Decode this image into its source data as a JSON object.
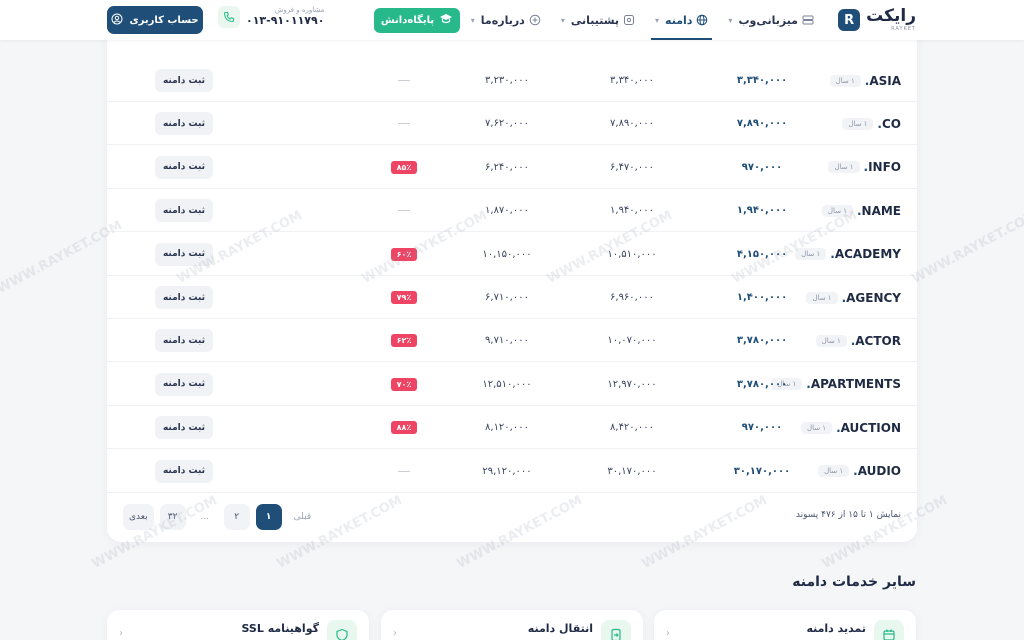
{
  "header": {
    "logo_text": "رایکت",
    "logo_sub": "RAYKET",
    "logo_mark": "R",
    "nav": [
      {
        "label": "میزبانی‌وب",
        "icon": "server-icon",
        "active": false
      },
      {
        "label": "دامنه",
        "icon": "globe-icon",
        "active": true
      },
      {
        "label": "پشتیبانی",
        "icon": "headset-icon",
        "active": false
      },
      {
        "label": "درباره‌ما",
        "icon": "plus-circle-icon",
        "active": false
      }
    ],
    "knowledge_base": "پایگاه‌دانش",
    "contact_label": "مشاوره و فروش",
    "contact_phone": "۰۱۳-۹۱۰۱۱۷۹۰",
    "account_button": "حساب کاربری"
  },
  "table": {
    "rows": [
      {
        "tld": "ASIA",
        "period": "۱ سال",
        "register": "۳,۳۴۰,۰۰۰",
        "renew": "۳,۳۴۰,۰۰۰",
        "transfer": "۳,۲۳۰,۰۰۰",
        "discount": "",
        "action": "ثبت دامنه"
      },
      {
        "tld": "CO",
        "period": "۱ سال",
        "register": "۷,۸۹۰,۰۰۰",
        "renew": "۷,۸۹۰,۰۰۰",
        "transfer": "۷,۶۲۰,۰۰۰",
        "discount": "",
        "action": "ثبت دامنه"
      },
      {
        "tld": "INFO",
        "period": "۱ سال",
        "register": "۹۷۰,۰۰۰",
        "renew": "۶,۴۷۰,۰۰۰",
        "transfer": "۶,۲۴۰,۰۰۰",
        "discount": "۸۵٪",
        "action": "ثبت دامنه"
      },
      {
        "tld": "NAME",
        "period": "۱ سال",
        "register": "۱,۹۴۰,۰۰۰",
        "renew": "۱,۹۴۰,۰۰۰",
        "transfer": "۱,۸۷۰,۰۰۰",
        "discount": "",
        "action": "ثبت دامنه"
      },
      {
        "tld": "ACADEMY",
        "period": "۱ سال",
        "register": "۴,۱۵۰,۰۰۰",
        "renew": "۱۰,۵۱۰,۰۰۰",
        "transfer": "۱۰,۱۵۰,۰۰۰",
        "discount": "۶۰٪",
        "action": "ثبت دامنه"
      },
      {
        "tld": "AGENCY",
        "period": "۱ سال",
        "register": "۱,۴۰۰,۰۰۰",
        "renew": "۶,۹۶۰,۰۰۰",
        "transfer": "۶,۷۱۰,۰۰۰",
        "discount": "۷۹٪",
        "action": "ثبت دامنه"
      },
      {
        "tld": "ACTOR",
        "period": "۱ سال",
        "register": "۳,۷۸۰,۰۰۰",
        "renew": "۱۰,۰۷۰,۰۰۰",
        "transfer": "۹,۷۱۰,۰۰۰",
        "discount": "۶۲٪",
        "action": "ثبت دامنه"
      },
      {
        "tld": "APARTMENTS",
        "period": "۱ سال",
        "register": "۳,۷۸۰,۰۰۰",
        "renew": "۱۲,۹۷۰,۰۰۰",
        "transfer": "۱۲,۵۱۰,۰۰۰",
        "discount": "۷۰٪",
        "action": "ثبت دامنه"
      },
      {
        "tld": "AUCTION",
        "period": "۱ سال",
        "register": "۹۷۰,۰۰۰",
        "renew": "۸,۴۲۰,۰۰۰",
        "transfer": "۸,۱۲۰,۰۰۰",
        "discount": "۸۸٪",
        "action": "ثبت دامنه"
      },
      {
        "tld": "AUDIO",
        "period": "۱ سال",
        "register": "۳۰,۱۷۰,۰۰۰",
        "renew": "۳۰,۱۷۰,۰۰۰",
        "transfer": "۲۹,۱۲۰,۰۰۰",
        "discount": "",
        "action": "ثبت دامنه"
      }
    ]
  },
  "pagination": {
    "info": "نمایش ۱ تا ۱۵ از ۴۷۶ پسوند",
    "prev": "قبلی",
    "pages": [
      "۱",
      "۲",
      "...",
      "۳۲"
    ],
    "current": "۱",
    "next": "بعدی"
  },
  "services": {
    "title": "سایر خدمات دامنه",
    "items": [
      {
        "label": "تمدید دامنه",
        "icon": "calendar-icon"
      },
      {
        "label": "انتقال دامنه",
        "icon": "transfer-icon"
      },
      {
        "label": "گواهینامه SSL",
        "icon": "shield-icon"
      }
    ]
  },
  "watermark": "WWW.RAYKET.COM",
  "colors": {
    "primary": "#1f4e79",
    "accent": "#27b98a",
    "discount": "#ef4565"
  }
}
